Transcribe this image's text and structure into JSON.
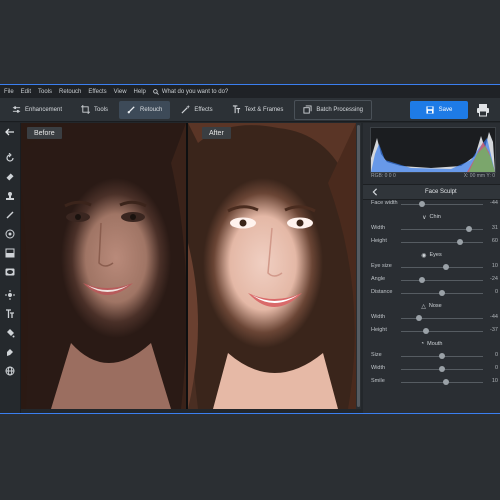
{
  "menu": {
    "items": [
      "File",
      "Edit",
      "Tools",
      "Retouch",
      "Effects",
      "View",
      "Help"
    ],
    "search_placeholder": "What do you want to do?"
  },
  "toolbar": {
    "buttons": [
      {
        "label": "Enhancement",
        "icon": "sliders-icon"
      },
      {
        "label": "Tools",
        "icon": "crop-icon"
      },
      {
        "label": "Retouch",
        "icon": "brush-icon"
      },
      {
        "label": "Effects",
        "icon": "wand-icon"
      },
      {
        "label": "Text & Frames",
        "icon": "text-icon"
      },
      {
        "label": "Batch Processing",
        "icon": "batch-icon"
      }
    ],
    "save_label": "Save"
  },
  "canvas": {
    "before_label": "Before",
    "after_label": "After"
  },
  "histogram": {
    "info_left": "RGB: 0 0 0",
    "info_right": "X: 00 mm Y: 0"
  },
  "panel": {
    "title": "Face Sculpt",
    "sliders": [
      {
        "label": "Face width",
        "value": "-44",
        "pos": 0.25
      },
      {
        "section": "Chin"
      },
      {
        "label": "Width",
        "value": "31",
        "pos": 0.83
      },
      {
        "label": "Height",
        "value": "60",
        "pos": 0.72
      },
      {
        "section": "Eyes"
      },
      {
        "label": "Eye size",
        "value": "10",
        "pos": 0.55
      },
      {
        "label": "Angle",
        "value": "-24",
        "pos": 0.25
      },
      {
        "label": "Distance",
        "value": "0",
        "pos": 0.5
      },
      {
        "section": "Nose"
      },
      {
        "label": "Width",
        "value": "-44",
        "pos": 0.22
      },
      {
        "label": "Height",
        "value": "-37",
        "pos": 0.3
      },
      {
        "section": "Mouth"
      },
      {
        "label": "Size",
        "value": "0",
        "pos": 0.5
      },
      {
        "label": "Width",
        "value": "0",
        "pos": 0.5
      },
      {
        "label": "Smile",
        "value": "10",
        "pos": 0.55
      }
    ]
  },
  "colors": {
    "accent": "#1e7be6",
    "border": "#3b7ff0"
  }
}
